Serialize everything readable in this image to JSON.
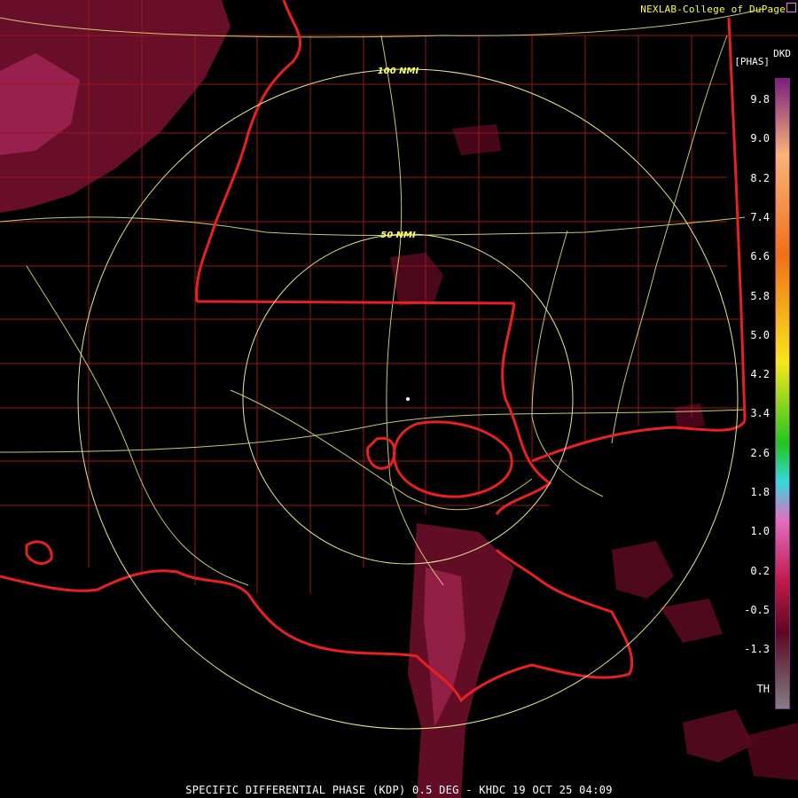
{
  "credit": "NEXLAB-College of DuPage",
  "product_code": "DKD",
  "units": "[PHAS]",
  "caption": "SPECIFIC DIFFERENTIAL PHASE (KDP) 0.5 DEG - KHDC 19 OCT 25 04:09",
  "range_rings": [
    {
      "label": "100 NMI"
    },
    {
      "label": "50 NMI"
    }
  ],
  "legend": {
    "ticks": [
      "9.8",
      "9.0",
      "8.2",
      "7.4",
      "6.6",
      "5.8",
      "5.0",
      "4.2",
      "3.4",
      "2.6",
      "1.8",
      "1.0",
      "0.2",
      "-0.5",
      "-1.3",
      "TH"
    ],
    "colors": {
      "high": "#7a1f7a",
      "peach": "#f7b57a",
      "orange": "#f07018",
      "yellow": "#f5e81a",
      "green": "#22c422",
      "cyan": "#36d8d8",
      "pink": "#e070c0",
      "crimson": "#c01848",
      "maroon": "#5a0820",
      "gray": "#808080"
    }
  },
  "map_colors": {
    "state_lines": "#e82020",
    "county_lines": "#9a1818",
    "highways": "#d8e07a",
    "rings": "#e8e890",
    "echo": "#7a1030"
  }
}
